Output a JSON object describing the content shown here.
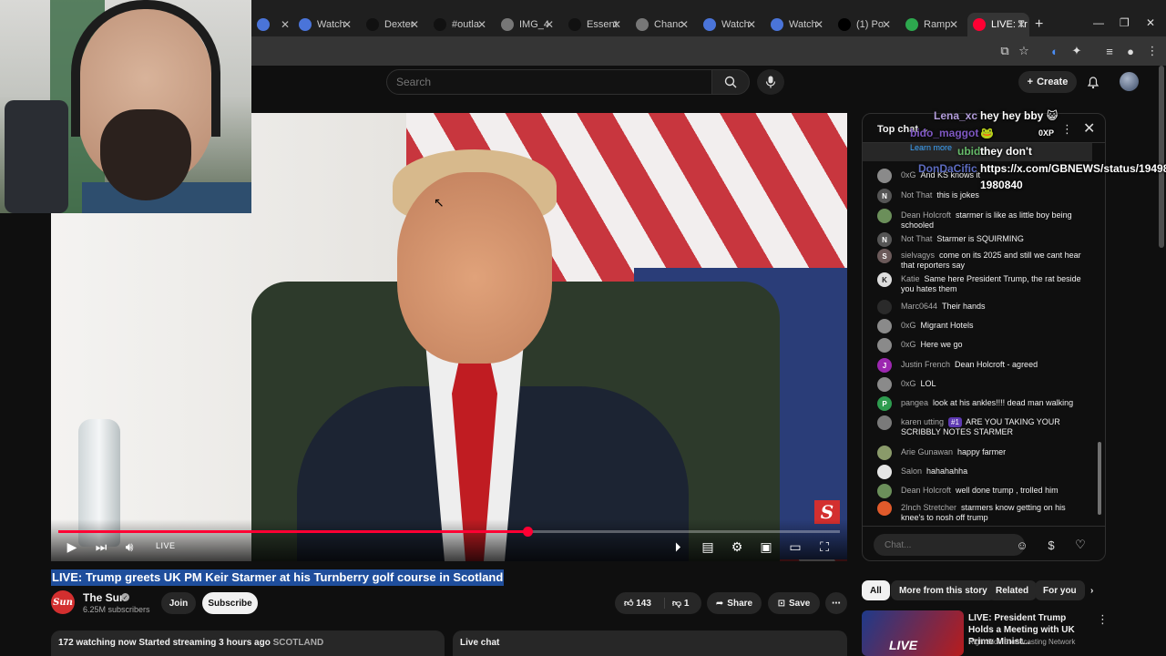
{
  "browser": {
    "tabs": [
      {
        "label": "",
        "icon_color": "#4a74d9"
      },
      {
        "label": "Watch",
        "icon_color": "#4a74d9"
      },
      {
        "label": "Dexter",
        "icon_color": "#111111"
      },
      {
        "label": "#outla",
        "icon_color": "#111111"
      },
      {
        "label": "IMG_4",
        "icon_color": "#777777"
      },
      {
        "label": "Essent",
        "icon_color": "#111111"
      },
      {
        "label": "Chanc",
        "icon_color": "#777777"
      },
      {
        "label": "Watch",
        "icon_color": "#4a74d9"
      },
      {
        "label": "Watch",
        "icon_color": "#4a74d9"
      },
      {
        "label": "(1) Po",
        "icon_color": "#000000"
      },
      {
        "label": "Ramp",
        "icon_color": "#2da84e"
      },
      {
        "label": "LIVE: Tr",
        "icon_color": "#ff0033",
        "active": true
      }
    ],
    "new_tab": "+",
    "window_controls": [
      "—",
      "❐",
      "✕"
    ]
  },
  "youtube": {
    "search_placeholder": "Search",
    "create_label": "Create"
  },
  "player": {
    "live_label": "LIVE",
    "progress_fraction": 0.6,
    "logo_letter": "S"
  },
  "video": {
    "title": "LIVE: Trump greets UK PM Keir Starmer at his Turnberry golf course in Scotland",
    "channel_logo": "Sun",
    "channel_name": "The Sun",
    "subscribers": "6.25M subscribers",
    "join_label": "Join",
    "subscribe_label": "Subscribe",
    "likes": "143",
    "dislikes": "1",
    "share_label": "Share",
    "save_label": "Save",
    "description_stats": "172 watching now  Started streaming 3 hours ago",
    "description_location": "SCOTLAND",
    "live_chat_label": "Live chat"
  },
  "chat": {
    "header": "Top chat",
    "pinned_learn": "Learn more",
    "input_placeholder": "Chat...",
    "messages": [
      {
        "author": "0xG",
        "text": "And KS knows it",
        "avatar_color": "#8a8a8a",
        "avatar_letter": ""
      },
      {
        "author": "Not That",
        "text": "this is jokes",
        "avatar_color": "#555555",
        "avatar_letter": "N"
      },
      {
        "author": "Dean Holcroft",
        "text": "starmer is like as little boy being schooled",
        "avatar_color": "#6b8f5a",
        "avatar_letter": ""
      },
      {
        "author": "Not That",
        "text": "Starmer is SQUIRMING",
        "avatar_color": "#555555",
        "avatar_letter": "N"
      },
      {
        "author": "sielvagys",
        "text": "come on its 2025 and still we cant hear that reporters say",
        "avatar_color": "#6b5a5a",
        "avatar_letter": "S"
      },
      {
        "author": "Katie",
        "text": "Same here President Trump, the rat beside you hates them",
        "avatar_color": "#dddddd",
        "avatar_letter": "K"
      },
      {
        "author": "Marc0644",
        "text": "Their hands",
        "avatar_color": "#2a2a2a",
        "avatar_letter": ""
      },
      {
        "author": "0xG",
        "text": "Migrant Hotels",
        "avatar_color": "#8a8a8a",
        "avatar_letter": ""
      },
      {
        "author": "0xG",
        "text": "Here we go",
        "avatar_color": "#8a8a8a",
        "avatar_letter": ""
      },
      {
        "author": "Justin French",
        "text": "Dean Holcroft - agreed",
        "avatar_color": "#9c27b0",
        "avatar_letter": "J"
      },
      {
        "author": "0xG",
        "text": "LOL",
        "avatar_color": "#8a8a8a",
        "avatar_letter": ""
      },
      {
        "author": "pangea",
        "text": "look at his ankles!!!! dead man walking",
        "avatar_color": "#2e9c4f",
        "avatar_letter": "P"
      },
      {
        "author": "karen utting",
        "badge": "#1",
        "text": "ARE YOU TAKING YOUR SCRIBBLY NOTES STARMER",
        "avatar_color": "#7a7a7a",
        "avatar_letter": ""
      },
      {
        "author": "Arie Gunawan",
        "text": "happy farmer",
        "avatar_color": "#8a9a6a",
        "avatar_letter": ""
      },
      {
        "author": "Salon",
        "text": "hahahahha",
        "avatar_color": "#e6e6e6",
        "avatar_letter": ""
      },
      {
        "author": "Dean Holcroft",
        "text": "well done trump , trolled him",
        "avatar_color": "#6b8f5a",
        "avatar_letter": ""
      },
      {
        "author": "2Inch Stretcher",
        "text": "starmers know getting on his knee's to nosh off trump",
        "avatar_color": "#e05a2b",
        "avatar_letter": ""
      }
    ]
  },
  "overlay_chat": [
    {
      "name": "Lena_xc",
      "name_color": "#b39ddb",
      "text": "hey hey bby 😺"
    },
    {
      "name": "bido_maggot",
      "name_color": "#7e57c2",
      "text": "🐸",
      "badge": "0XP"
    },
    {
      "name": "ubido",
      "name_color": "#66bb6a",
      "text": "they don't"
    },
    {
      "name": "DonDaCific",
      "name_color": "#5c6bc0",
      "text": "https://x.com/GBNEWS/status/19498"
    },
    {
      "name": "",
      "name_color": "#ffffff",
      "text": "1980840"
    }
  ],
  "related": {
    "chips": [
      {
        "label": "All",
        "active": true
      },
      {
        "label": "More from this story"
      },
      {
        "label": "Related"
      },
      {
        "label": "For you"
      }
    ],
    "items": [
      {
        "title": "LIVE: President Trump Holds a Meeting with UK Prime Minist...",
        "channel": "Right Side Broadcasting Network",
        "thumb_tag": "LIVE"
      }
    ]
  }
}
